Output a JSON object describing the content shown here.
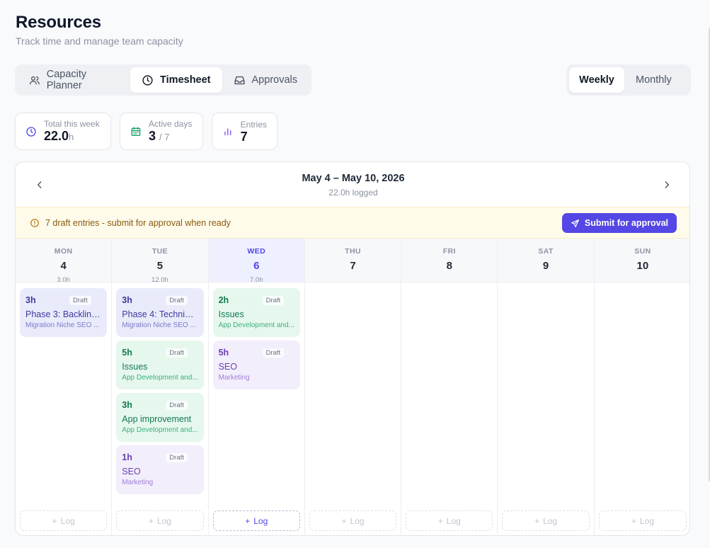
{
  "page": {
    "title": "Resources",
    "subtitle": "Track time and manage team capacity"
  },
  "tabs": [
    {
      "label": "Capacity Planner",
      "icon": "users-icon",
      "active": false
    },
    {
      "label": "Timesheet",
      "icon": "clock-icon",
      "active": true
    },
    {
      "label": "Approvals",
      "icon": "inbox-icon",
      "active": false
    }
  ],
  "view_toggle": {
    "weekly": "Weekly",
    "monthly": "Monthly",
    "selected": "Weekly"
  },
  "stats": {
    "total": {
      "label": "Total this week",
      "value": "22.0",
      "unit": "h",
      "icon": "clock-icon"
    },
    "active_days": {
      "label": "Active days",
      "value": "3",
      "unit": "/ 7",
      "icon": "calendar-icon"
    },
    "entries": {
      "label": "Entries",
      "value": "7",
      "icon": "bar-chart-icon"
    }
  },
  "calendar": {
    "range": "May 4 – May 10, 2026",
    "logged": "22.0h logged",
    "banner": "7 draft entries - submit for approval when ready",
    "submit_label": "Submit for approval",
    "log_label": "Log",
    "colors": {
      "accent": "#5447e5",
      "banner_bg": "#fefbea"
    },
    "days": [
      {
        "dow": "MON",
        "num": "4",
        "hours": "3.0h",
        "today": false,
        "entries": [
          {
            "hours": "3h",
            "badge": "Draft",
            "title": "Phase 3: Backlink ...",
            "sub": "Migration Niche SEO ...",
            "color": "indigo"
          }
        ]
      },
      {
        "dow": "TUE",
        "num": "5",
        "hours": "12.0h",
        "today": false,
        "entries": [
          {
            "hours": "3h",
            "badge": "Draft",
            "title": "Phase 4: Technical ...",
            "sub": "Migration Niche SEO ...",
            "color": "indigo"
          },
          {
            "hours": "5h",
            "badge": "Draft",
            "title": "Issues",
            "sub": "App Development and...",
            "color": "green"
          },
          {
            "hours": "3h",
            "badge": "Draft",
            "title": "App improvement",
            "sub": "App Development and...",
            "color": "green"
          },
          {
            "hours": "1h",
            "badge": "Draft",
            "title": "SEO",
            "sub": "Marketing",
            "color": "purple"
          }
        ]
      },
      {
        "dow": "WED",
        "num": "6",
        "hours": "7.0h",
        "today": true,
        "entries": [
          {
            "hours": "2h",
            "badge": "Draft",
            "title": "Issues",
            "sub": "App Development and...",
            "color": "green"
          },
          {
            "hours": "5h",
            "badge": "Draft",
            "title": "SEO",
            "sub": "Marketing",
            "color": "purple"
          }
        ]
      },
      {
        "dow": "THU",
        "num": "7",
        "hours": "",
        "today": false,
        "entries": []
      },
      {
        "dow": "FRI",
        "num": "8",
        "hours": "",
        "today": false,
        "entries": []
      },
      {
        "dow": "SAT",
        "num": "9",
        "hours": "",
        "today": false,
        "entries": []
      },
      {
        "dow": "SUN",
        "num": "10",
        "hours": "",
        "today": false,
        "entries": []
      }
    ]
  }
}
